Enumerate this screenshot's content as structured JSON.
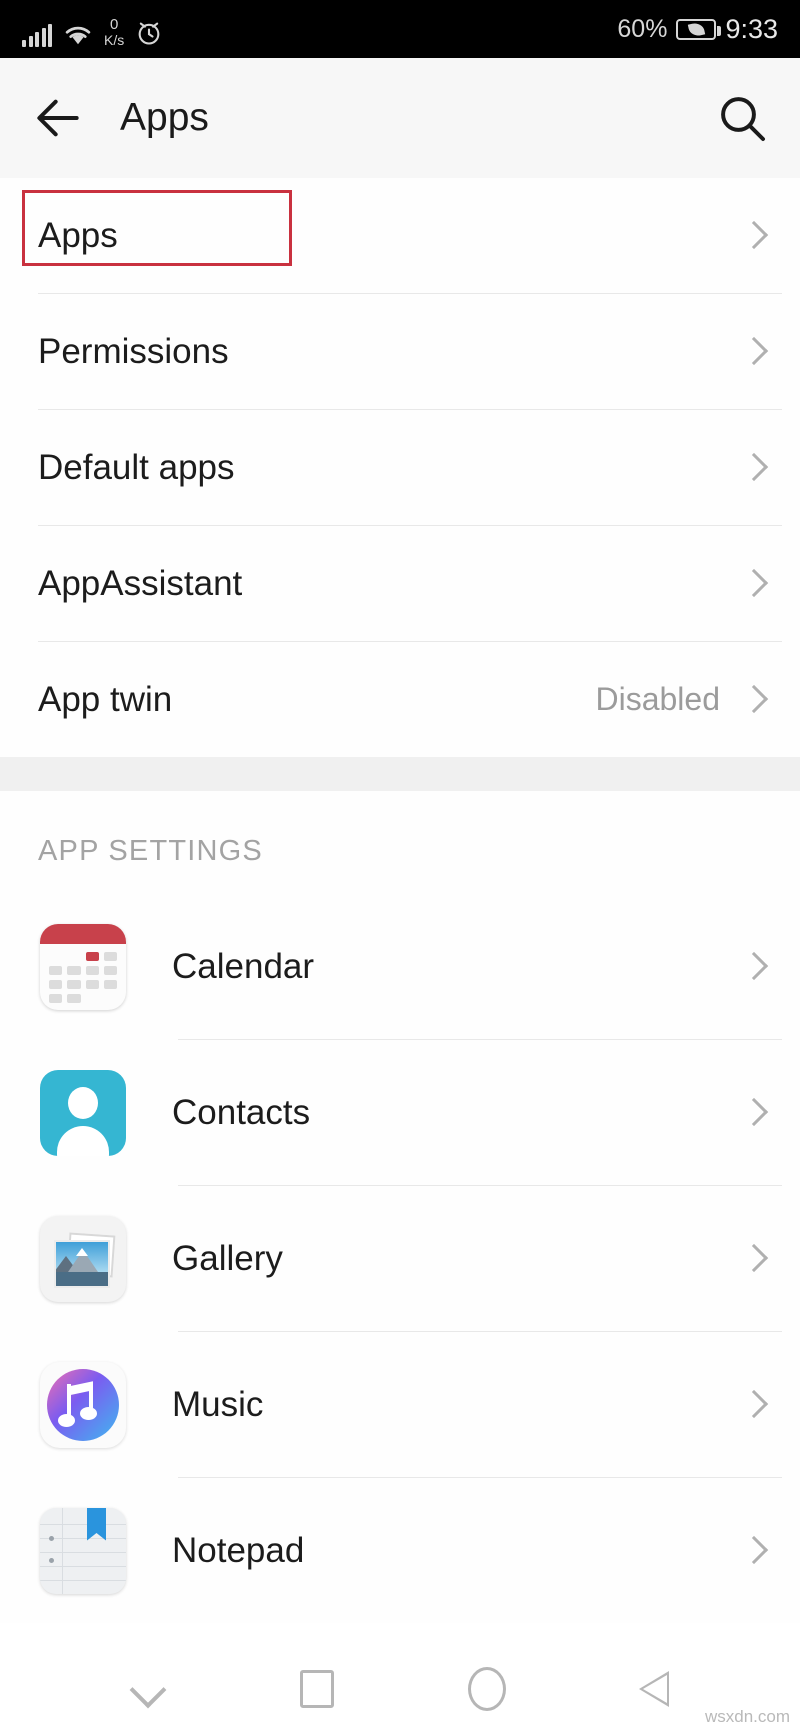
{
  "status_bar": {
    "network_speed_value": "0",
    "network_speed_unit": "K/s",
    "battery_percent": "60%",
    "time": "9:33",
    "icons": [
      "signal-icon",
      "wifi-icon",
      "network-speed-icon",
      "alarm-icon",
      "battery-saver-icon"
    ]
  },
  "app_bar": {
    "title": "Apps",
    "back_icon": "back-arrow-icon",
    "search_icon": "search-icon"
  },
  "settings_rows": [
    {
      "label": "Apps",
      "value": "",
      "highlighted": true
    },
    {
      "label": "Permissions",
      "value": "",
      "highlighted": false
    },
    {
      "label": "Default apps",
      "value": "",
      "highlighted": false
    },
    {
      "label": "AppAssistant",
      "value": "",
      "highlighted": false
    },
    {
      "label": "App twin",
      "value": "Disabled",
      "highlighted": false
    }
  ],
  "app_settings": {
    "header": "APP SETTINGS",
    "apps": [
      {
        "label": "Calendar",
        "icon": "calendar-app-icon"
      },
      {
        "label": "Contacts",
        "icon": "contacts-app-icon"
      },
      {
        "label": "Gallery",
        "icon": "gallery-app-icon"
      },
      {
        "label": "Music",
        "icon": "music-app-icon"
      },
      {
        "label": "Notepad",
        "icon": "notepad-app-icon"
      }
    ]
  },
  "nav_bar": {
    "hide_label": "chevron-down-icon",
    "recents_label": "square-recents-icon",
    "home_label": "circle-home-icon",
    "back_label": "triangle-back-icon"
  },
  "watermark": "wsxdn.com",
  "colors": {
    "annotation": "#c9313f",
    "status_bar_bg": "#000000",
    "app_bar_bg": "#f7f7f7",
    "calendar_red": "#c8414b",
    "contacts_cyan": "#35b6d2",
    "notepad_blue": "#2a94dd"
  }
}
